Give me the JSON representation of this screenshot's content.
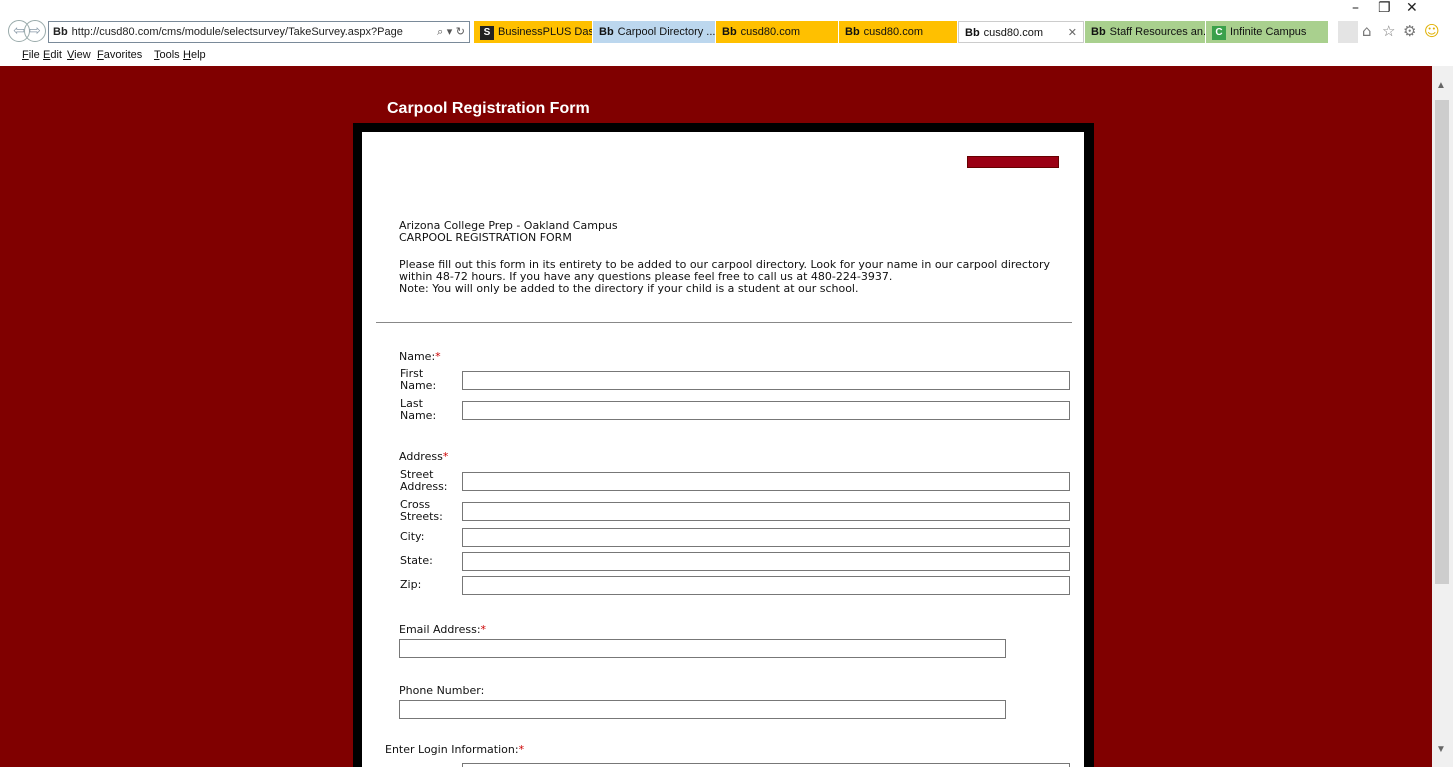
{
  "browser": {
    "address": "http://cusd80.com/cms/module/selectsurvey/TakeSurvey.aspx?Page",
    "favicon": "Bb",
    "tabs": [
      {
        "icon": "S",
        "label": "BusinessPLUS Das...",
        "color": "#ffc000"
      },
      {
        "icon": "Bb",
        "label": "Carpool Directory ...",
        "color": "#bcd7ee"
      },
      {
        "icon": "Bb",
        "label": "cusd80.com",
        "color": "#ffc000"
      },
      {
        "icon": "Bb",
        "label": "cusd80.com",
        "color": "#ffc000"
      },
      {
        "icon": "Bb",
        "label": "cusd80.com",
        "color": "#ffffff"
      },
      {
        "icon": "Bb",
        "label": "Staff Resources an...",
        "color": "#a9d08e"
      },
      {
        "icon": "C",
        "label": "Infinite Campus",
        "color": "#a9d08e"
      }
    ],
    "menu": [
      "File",
      "Edit",
      "View",
      "Favorites",
      "Tools",
      "Help"
    ]
  },
  "page": {
    "title": "Carpool Registration Form",
    "background": "#800000",
    "school": "Arizona College Prep - Oakland Campus",
    "form_name": "CARPOOL REGISTRATION FORM",
    "intro": [
      "Please fill out this form in its entirety to be added to our carpool directory. Look for your name in our carpool directory",
      "within 48-72 hours. If you have any questions please feel free to call us at 480-224-3937.",
      "Note: You will only be added to the directory if your child is a student at our school."
    ],
    "name_section": {
      "label": "Name:",
      "required": "*",
      "first_label": [
        "First",
        "Name:"
      ],
      "last_label": [
        "Last",
        "Name:"
      ]
    },
    "address_section": {
      "label": "Address",
      "required": "*",
      "street_label": [
        "Street",
        "Address:"
      ],
      "cross_label": [
        "Cross",
        "Streets:"
      ],
      "city_label": "City:",
      "state_label": "State:",
      "zip_label": "Zip:"
    },
    "email": {
      "label": "Email Address:",
      "required": "*"
    },
    "phone": {
      "label": "Phone Number:"
    },
    "login": {
      "label": "Enter Login Information:",
      "required": "*"
    }
  }
}
